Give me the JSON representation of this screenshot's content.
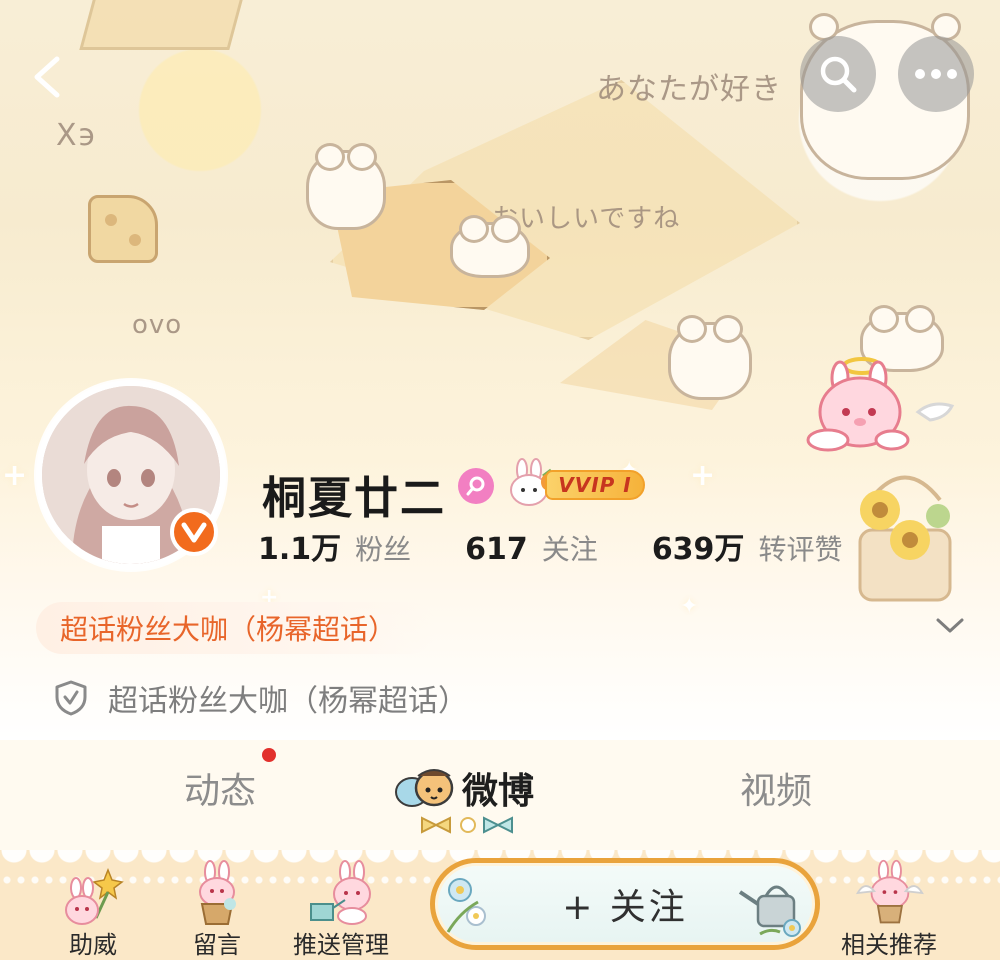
{
  "header": {
    "back_icon": "chevron-left-icon",
    "search_icon": "search-icon",
    "more_icon": "more-horizontal-icon",
    "decor_text_1": "あなたが好き",
    "decor_text_2": "おいしいですね",
    "decor_text_3": "X϶",
    "decor_text_4": "ovo"
  },
  "profile": {
    "name": "桐夏廿二",
    "gender_icon": "female-icon",
    "vip_label": "VVIP I",
    "verified_icon": "verified-v-icon",
    "stats": [
      {
        "value": "1.1万",
        "label": "粉丝"
      },
      {
        "value": "617",
        "label": "关注"
      },
      {
        "value": "639万",
        "label": "转评赞"
      }
    ],
    "tag_chip": "超话粉丝大咖（杨幂超话）",
    "badge_text": "超话粉丝大咖（杨幂超话）",
    "badge_icon": "shield-check-icon",
    "expand_icon": "chevron-down-icon"
  },
  "tabs": [
    {
      "label": "动态",
      "has_dot": true
    },
    {
      "label": "微博",
      "active": true
    },
    {
      "label": "视频"
    }
  ],
  "bottom_bar": {
    "items": [
      {
        "label": "助威"
      },
      {
        "label": "留言"
      },
      {
        "label": "推送管理"
      },
      {
        "label": "相关推荐"
      }
    ],
    "follow_label": "+ 关注"
  },
  "colors": {
    "accent_orange": "#e8652a",
    "follow_border": "#e9a33c",
    "notification_dot": "#e2302c",
    "vip_gold": "#f6b23a",
    "female_pink": "#f27fc2"
  }
}
